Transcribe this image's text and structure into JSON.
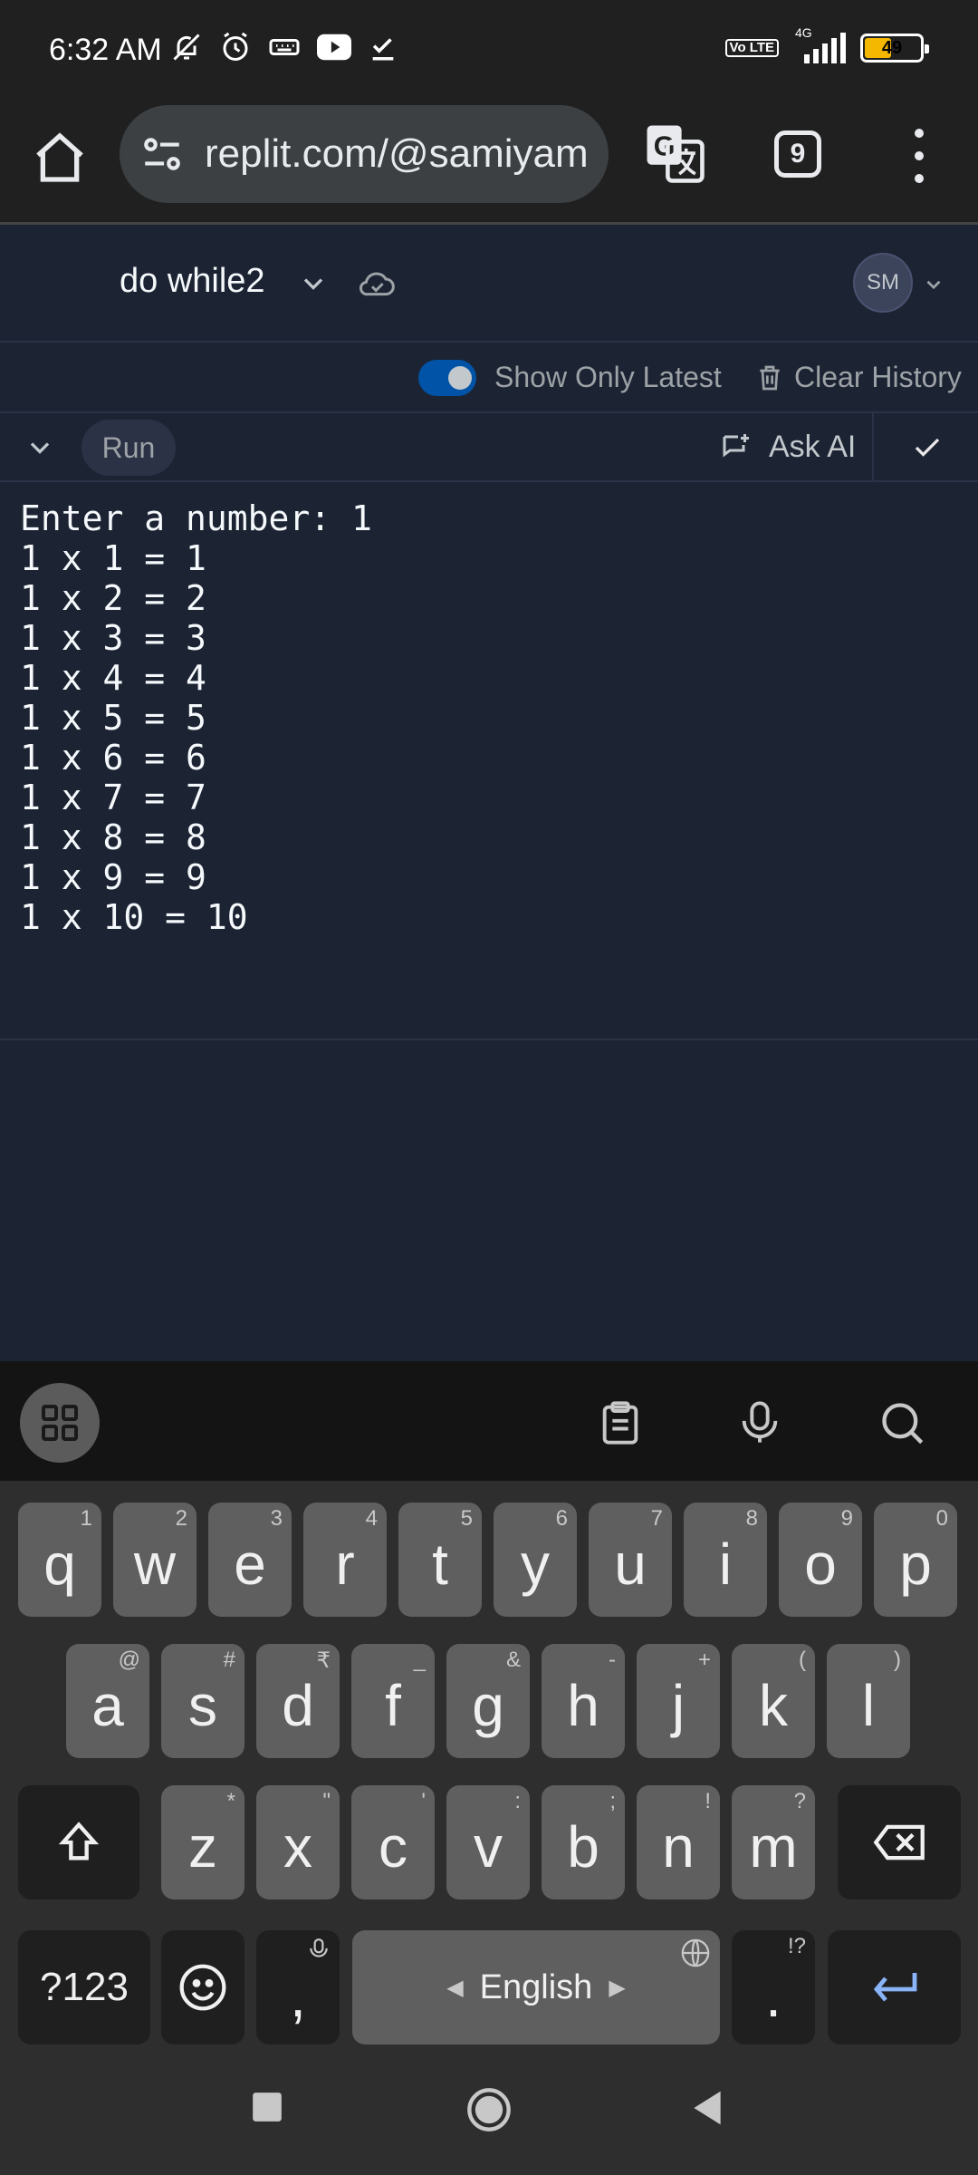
{
  "status_bar": {
    "time": "6:32 AM",
    "network": "4G",
    "lte_label": "Vo LTE",
    "battery": "49",
    "battery_level": 0.49
  },
  "browser": {
    "url": "replit.com/@samiyam",
    "tab_count": "9"
  },
  "replit": {
    "repl_name": "do while2",
    "avatar_initials": "SM",
    "show_only_latest": "Show Only Latest",
    "clear_history": "Clear History",
    "run_label": "Run",
    "ask_ai_label": "Ask AI"
  },
  "console": {
    "lines": [
      "Enter a number: 1",
      "1 x 1 = 1",
      "1 x 2 = 2",
      "1 x 3 = 3",
      "1 x 4 = 4",
      "1 x 5 = 5",
      "1 x 6 = 6",
      "1 x 7 = 7",
      "1 x 8 = 8",
      "1 x 9 = 9",
      "1 x 10 = 10"
    ]
  },
  "keyboard": {
    "row1": [
      {
        "key": "q",
        "hint": "1"
      },
      {
        "key": "w",
        "hint": "2"
      },
      {
        "key": "e",
        "hint": "3"
      },
      {
        "key": "r",
        "hint": "4"
      },
      {
        "key": "t",
        "hint": "5"
      },
      {
        "key": "y",
        "hint": "6"
      },
      {
        "key": "u",
        "hint": "7"
      },
      {
        "key": "i",
        "hint": "8"
      },
      {
        "key": "o",
        "hint": "9"
      },
      {
        "key": "p",
        "hint": "0"
      }
    ],
    "row2": [
      {
        "key": "a",
        "hint": "@"
      },
      {
        "key": "s",
        "hint": "#"
      },
      {
        "key": "d",
        "hint": "₹"
      },
      {
        "key": "f",
        "hint": "_"
      },
      {
        "key": "g",
        "hint": "&"
      },
      {
        "key": "h",
        "hint": "-"
      },
      {
        "key": "j",
        "hint": "+"
      },
      {
        "key": "k",
        "hint": "("
      },
      {
        "key": "l",
        "hint": ")"
      }
    ],
    "row3": [
      {
        "key": "z",
        "hint": "*"
      },
      {
        "key": "x",
        "hint": "\""
      },
      {
        "key": "c",
        "hint": "'"
      },
      {
        "key": "v",
        "hint": ":"
      },
      {
        "key": "b",
        "hint": ";"
      },
      {
        "key": "n",
        "hint": "!"
      },
      {
        "key": "m",
        "hint": "?"
      }
    ],
    "symbols_key": "?123",
    "comma_key": ",",
    "space_label": "English",
    "period_key": ".",
    "period_hint": "!?"
  },
  "colors": {
    "replit_bg": "#1c2333",
    "toggle_on": "#0053a6",
    "battery_fill": "#f5b800",
    "enter_key_arrow": "#8ab4f8"
  }
}
